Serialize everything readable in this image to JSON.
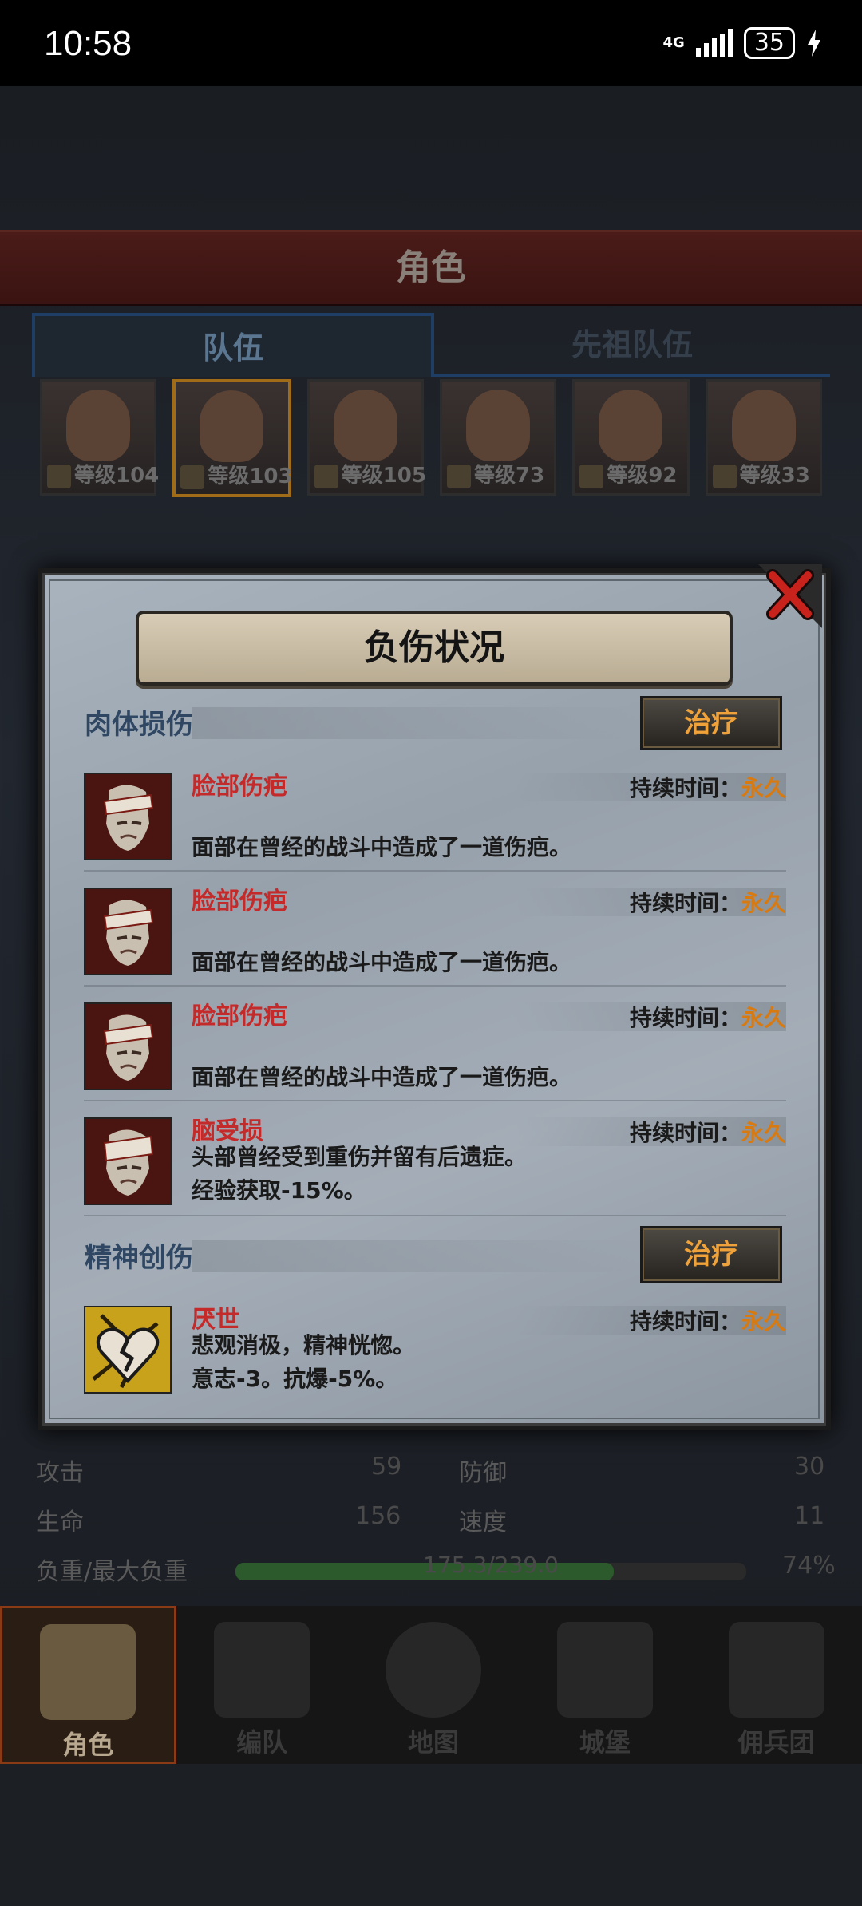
{
  "status_bar": {
    "time": "10:58",
    "network": "4G",
    "battery": "35"
  },
  "screen": {
    "title": "角色",
    "tabs": [
      "队伍",
      "先祖队伍"
    ]
  },
  "heroes": [
    {
      "level_label": "等级104"
    },
    {
      "level_label": "等级103"
    },
    {
      "level_label": "等级105"
    },
    {
      "level_label": "等级73"
    },
    {
      "level_label": "等级92"
    },
    {
      "level_label": "等级33"
    }
  ],
  "stats": {
    "attack_label": "攻击",
    "attack": "59",
    "defense_label": "防御",
    "defense": "30",
    "hp_label": "生命",
    "hp": "156",
    "speed_label": "速度",
    "speed": "11",
    "load_label": "负重/最大负重",
    "load": "175.3/239.0",
    "load_percent": "74%",
    "load_fraction": 0.74
  },
  "bottom_nav": [
    {
      "label": "角色",
      "active": true
    },
    {
      "label": "编队"
    },
    {
      "label": "地图"
    },
    {
      "label": "城堡"
    },
    {
      "label": "佣兵团"
    }
  ],
  "modal": {
    "title": "负伤状况",
    "physical": {
      "title": "肉体损伤",
      "heal_label": "治疗",
      "items": [
        {
          "name": "脸部伤疤",
          "desc1": "面部在曾经的战斗中造成了一道伤疤。",
          "desc2": "",
          "duration_label": "持续时间：",
          "duration": "永久"
        },
        {
          "name": "脸部伤疤",
          "desc1": "面部在曾经的战斗中造成了一道伤疤。",
          "desc2": "",
          "duration_label": "持续时间：",
          "duration": "永久"
        },
        {
          "name": "脸部伤疤",
          "desc1": "面部在曾经的战斗中造成了一道伤疤。",
          "desc2": "",
          "duration_label": "持续时间：",
          "duration": "永久"
        },
        {
          "name": "脑受损",
          "desc1": "头部曾经受到重伤并留有后遗症。",
          "desc2": "经验获取-15%。",
          "duration_label": "持续时间：",
          "duration": "永久"
        }
      ]
    },
    "mental": {
      "title": "精神创伤",
      "heal_label": "治疗",
      "items": [
        {
          "name": "厌世",
          "desc1": "悲观消极，精神恍惚。",
          "desc2": "意志-3。抗爆-5%。",
          "duration_label": "持续时间：",
          "duration": "永久"
        }
      ]
    }
  },
  "colors": {
    "injury_name": "#c42a2a",
    "duration_value": "#d87a10",
    "section_title": "#2f4763",
    "heal_text": "#f0a23a"
  }
}
